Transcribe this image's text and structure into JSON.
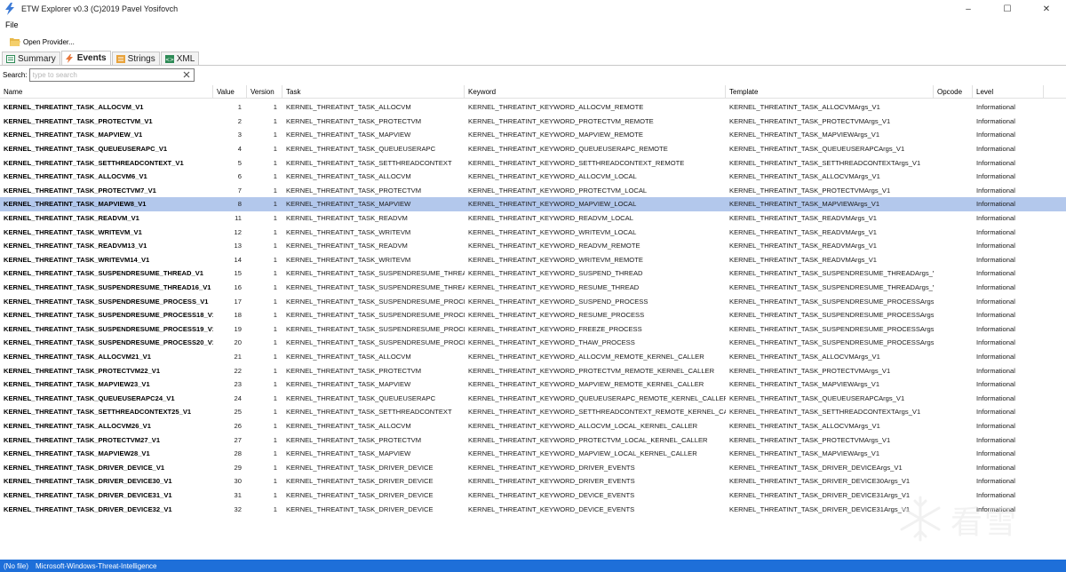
{
  "window": {
    "title": "ETW Explorer v0.3 (C)2019 Pavel Yosifovch",
    "minimize": "–",
    "maximize": "☐",
    "close": "✕"
  },
  "menu": {
    "file": "File"
  },
  "toolbar": {
    "open_provider": "Open Provider..."
  },
  "tabs": [
    {
      "label": "Summary",
      "icon": "summary-icon",
      "active": false
    },
    {
      "label": "Events",
      "icon": "lightning-icon",
      "active": true
    },
    {
      "label": "Strings",
      "icon": "strings-icon",
      "active": false
    },
    {
      "label": "XML",
      "icon": "xml-icon",
      "active": false
    }
  ],
  "search": {
    "label": "Search:",
    "placeholder": "type to search",
    "value": ""
  },
  "columns": {
    "name": "Name",
    "value": "Value",
    "version": "Version",
    "task": "Task",
    "keyword": "Keyword",
    "template": "Template",
    "opcode": "Opcode",
    "level": "Level"
  },
  "rows": [
    [
      "KERNEL_THREATINT_TASK_ALLOCVM_V1",
      "1",
      "1",
      "KERNEL_THREATINT_TASK_ALLOCVM",
      "KERNEL_THREATINT_KEYWORD_ALLOCVM_REMOTE",
      "KERNEL_THREATINT_TASK_ALLOCVMArgs_V1",
      "",
      "Informational"
    ],
    [
      "KERNEL_THREATINT_TASK_PROTECTVM_V1",
      "2",
      "1",
      "KERNEL_THREATINT_TASK_PROTECTVM",
      "KERNEL_THREATINT_KEYWORD_PROTECTVM_REMOTE",
      "KERNEL_THREATINT_TASK_PROTECTVMArgs_V1",
      "",
      "Informational"
    ],
    [
      "KERNEL_THREATINT_TASK_MAPVIEW_V1",
      "3",
      "1",
      "KERNEL_THREATINT_TASK_MAPVIEW",
      "KERNEL_THREATINT_KEYWORD_MAPVIEW_REMOTE",
      "KERNEL_THREATINT_TASK_MAPVIEWArgs_V1",
      "",
      "Informational"
    ],
    [
      "KERNEL_THREATINT_TASK_QUEUEUSERAPC_V1",
      "4",
      "1",
      "KERNEL_THREATINT_TASK_QUEUEUSERAPC",
      "KERNEL_THREATINT_KEYWORD_QUEUEUSERAPC_REMOTE",
      "KERNEL_THREATINT_TASK_QUEUEUSERAPCArgs_V1",
      "",
      "Informational"
    ],
    [
      "KERNEL_THREATINT_TASK_SETTHREADCONTEXT_V1",
      "5",
      "1",
      "KERNEL_THREATINT_TASK_SETTHREADCONTEXT",
      "KERNEL_THREATINT_KEYWORD_SETTHREADCONTEXT_REMOTE",
      "KERNEL_THREATINT_TASK_SETTHREADCONTEXTArgs_V1",
      "",
      "Informational"
    ],
    [
      "KERNEL_THREATINT_TASK_ALLOCVM6_V1",
      "6",
      "1",
      "KERNEL_THREATINT_TASK_ALLOCVM",
      "KERNEL_THREATINT_KEYWORD_ALLOCVM_LOCAL",
      "KERNEL_THREATINT_TASK_ALLOCVMArgs_V1",
      "",
      "Informational"
    ],
    [
      "KERNEL_THREATINT_TASK_PROTECTVM7_V1",
      "7",
      "1",
      "KERNEL_THREATINT_TASK_PROTECTVM",
      "KERNEL_THREATINT_KEYWORD_PROTECTVM_LOCAL",
      "KERNEL_THREATINT_TASK_PROTECTVMArgs_V1",
      "",
      "Informational"
    ],
    [
      "KERNEL_THREATINT_TASK_MAPVIEW8_V1",
      "8",
      "1",
      "KERNEL_THREATINT_TASK_MAPVIEW",
      "KERNEL_THREATINT_KEYWORD_MAPVIEW_LOCAL",
      "KERNEL_THREATINT_TASK_MAPVIEWArgs_V1",
      "",
      "Informational"
    ],
    [
      "KERNEL_THREATINT_TASK_READVM_V1",
      "11",
      "1",
      "KERNEL_THREATINT_TASK_READVM",
      "KERNEL_THREATINT_KEYWORD_READVM_LOCAL",
      "KERNEL_THREATINT_TASK_READVMArgs_V1",
      "",
      "Informational"
    ],
    [
      "KERNEL_THREATINT_TASK_WRITEVM_V1",
      "12",
      "1",
      "KERNEL_THREATINT_TASK_WRITEVM",
      "KERNEL_THREATINT_KEYWORD_WRITEVM_LOCAL",
      "KERNEL_THREATINT_TASK_READVMArgs_V1",
      "",
      "Informational"
    ],
    [
      "KERNEL_THREATINT_TASK_READVM13_V1",
      "13",
      "1",
      "KERNEL_THREATINT_TASK_READVM",
      "KERNEL_THREATINT_KEYWORD_READVM_REMOTE",
      "KERNEL_THREATINT_TASK_READVMArgs_V1",
      "",
      "Informational"
    ],
    [
      "KERNEL_THREATINT_TASK_WRITEVM14_V1",
      "14",
      "1",
      "KERNEL_THREATINT_TASK_WRITEVM",
      "KERNEL_THREATINT_KEYWORD_WRITEVM_REMOTE",
      "KERNEL_THREATINT_TASK_READVMArgs_V1",
      "",
      "Informational"
    ],
    [
      "KERNEL_THREATINT_TASK_SUSPENDRESUME_THREAD_V1",
      "15",
      "1",
      "KERNEL_THREATINT_TASK_SUSPENDRESUME_THREAD",
      "KERNEL_THREATINT_KEYWORD_SUSPEND_THREAD",
      "KERNEL_THREATINT_TASK_SUSPENDRESUME_THREADArgs_V1",
      "",
      "Informational"
    ],
    [
      "KERNEL_THREATINT_TASK_SUSPENDRESUME_THREAD16_V1",
      "16",
      "1",
      "KERNEL_THREATINT_TASK_SUSPENDRESUME_THREAD",
      "KERNEL_THREATINT_KEYWORD_RESUME_THREAD",
      "KERNEL_THREATINT_TASK_SUSPENDRESUME_THREADArgs_V1",
      "",
      "Informational"
    ],
    [
      "KERNEL_THREATINT_TASK_SUSPENDRESUME_PROCESS_V1",
      "17",
      "1",
      "KERNEL_THREATINT_TASK_SUSPENDRESUME_PROCESS",
      "KERNEL_THREATINT_KEYWORD_SUSPEND_PROCESS",
      "KERNEL_THREATINT_TASK_SUSPENDRESUME_PROCESSArgs_V1",
      "",
      "Informational"
    ],
    [
      "KERNEL_THREATINT_TASK_SUSPENDRESUME_PROCESS18_V1",
      "18",
      "1",
      "KERNEL_THREATINT_TASK_SUSPENDRESUME_PROCESS",
      "KERNEL_THREATINT_KEYWORD_RESUME_PROCESS",
      "KERNEL_THREATINT_TASK_SUSPENDRESUME_PROCESSArgs_V1",
      "",
      "Informational"
    ],
    [
      "KERNEL_THREATINT_TASK_SUSPENDRESUME_PROCESS19_V1",
      "19",
      "1",
      "KERNEL_THREATINT_TASK_SUSPENDRESUME_PROCESS",
      "KERNEL_THREATINT_KEYWORD_FREEZE_PROCESS",
      "KERNEL_THREATINT_TASK_SUSPENDRESUME_PROCESSArgs_V1",
      "",
      "Informational"
    ],
    [
      "KERNEL_THREATINT_TASK_SUSPENDRESUME_PROCESS20_V1",
      "20",
      "1",
      "KERNEL_THREATINT_TASK_SUSPENDRESUME_PROCESS",
      "KERNEL_THREATINT_KEYWORD_THAW_PROCESS",
      "KERNEL_THREATINT_TASK_SUSPENDRESUME_PROCESSArgs_V1",
      "",
      "Informational"
    ],
    [
      "KERNEL_THREATINT_TASK_ALLOCVM21_V1",
      "21",
      "1",
      "KERNEL_THREATINT_TASK_ALLOCVM",
      "KERNEL_THREATINT_KEYWORD_ALLOCVM_REMOTE_KERNEL_CALLER",
      "KERNEL_THREATINT_TASK_ALLOCVMArgs_V1",
      "",
      "Informational"
    ],
    [
      "KERNEL_THREATINT_TASK_PROTECTVM22_V1",
      "22",
      "1",
      "KERNEL_THREATINT_TASK_PROTECTVM",
      "KERNEL_THREATINT_KEYWORD_PROTECTVM_REMOTE_KERNEL_CALLER",
      "KERNEL_THREATINT_TASK_PROTECTVMArgs_V1",
      "",
      "Informational"
    ],
    [
      "KERNEL_THREATINT_TASK_MAPVIEW23_V1",
      "23",
      "1",
      "KERNEL_THREATINT_TASK_MAPVIEW",
      "KERNEL_THREATINT_KEYWORD_MAPVIEW_REMOTE_KERNEL_CALLER",
      "KERNEL_THREATINT_TASK_MAPVIEWArgs_V1",
      "",
      "Informational"
    ],
    [
      "KERNEL_THREATINT_TASK_QUEUEUSERAPC24_V1",
      "24",
      "1",
      "KERNEL_THREATINT_TASK_QUEUEUSERAPC",
      "KERNEL_THREATINT_KEYWORD_QUEUEUSERAPC_REMOTE_KERNEL_CALLER",
      "KERNEL_THREATINT_TASK_QUEUEUSERAPCArgs_V1",
      "",
      "Informational"
    ],
    [
      "KERNEL_THREATINT_TASK_SETTHREADCONTEXT25_V1",
      "25",
      "1",
      "KERNEL_THREATINT_TASK_SETTHREADCONTEXT",
      "KERNEL_THREATINT_KEYWORD_SETTHREADCONTEXT_REMOTE_KERNEL_CALLER",
      "KERNEL_THREATINT_TASK_SETTHREADCONTEXTArgs_V1",
      "",
      "Informational"
    ],
    [
      "KERNEL_THREATINT_TASK_ALLOCVM26_V1",
      "26",
      "1",
      "KERNEL_THREATINT_TASK_ALLOCVM",
      "KERNEL_THREATINT_KEYWORD_ALLOCVM_LOCAL_KERNEL_CALLER",
      "KERNEL_THREATINT_TASK_ALLOCVMArgs_V1",
      "",
      "Informational"
    ],
    [
      "KERNEL_THREATINT_TASK_PROTECTVM27_V1",
      "27",
      "1",
      "KERNEL_THREATINT_TASK_PROTECTVM",
      "KERNEL_THREATINT_KEYWORD_PROTECTVM_LOCAL_KERNEL_CALLER",
      "KERNEL_THREATINT_TASK_PROTECTVMArgs_V1",
      "",
      "Informational"
    ],
    [
      "KERNEL_THREATINT_TASK_MAPVIEW28_V1",
      "28",
      "1",
      "KERNEL_THREATINT_TASK_MAPVIEW",
      "KERNEL_THREATINT_KEYWORD_MAPVIEW_LOCAL_KERNEL_CALLER",
      "KERNEL_THREATINT_TASK_MAPVIEWArgs_V1",
      "",
      "Informational"
    ],
    [
      "KERNEL_THREATINT_TASK_DRIVER_DEVICE_V1",
      "29",
      "1",
      "KERNEL_THREATINT_TASK_DRIVER_DEVICE",
      "KERNEL_THREATINT_KEYWORD_DRIVER_EVENTS",
      "KERNEL_THREATINT_TASK_DRIVER_DEVICEArgs_V1",
      "",
      "Informational"
    ],
    [
      "KERNEL_THREATINT_TASK_DRIVER_DEVICE30_V1",
      "30",
      "1",
      "KERNEL_THREATINT_TASK_DRIVER_DEVICE",
      "KERNEL_THREATINT_KEYWORD_DRIVER_EVENTS",
      "KERNEL_THREATINT_TASK_DRIVER_DEVICE30Args_V1",
      "",
      "Informational"
    ],
    [
      "KERNEL_THREATINT_TASK_DRIVER_DEVICE31_V1",
      "31",
      "1",
      "KERNEL_THREATINT_TASK_DRIVER_DEVICE",
      "KERNEL_THREATINT_KEYWORD_DEVICE_EVENTS",
      "KERNEL_THREATINT_TASK_DRIVER_DEVICE31Args_V1",
      "",
      "Informational"
    ],
    [
      "KERNEL_THREATINT_TASK_DRIVER_DEVICE32_V1",
      "32",
      "1",
      "KERNEL_THREATINT_TASK_DRIVER_DEVICE",
      "KERNEL_THREATINT_KEYWORD_DEVICE_EVENTS",
      "KERNEL_THREATINT_TASK_DRIVER_DEVICE31Args_V1",
      "",
      "Informational"
    ]
  ],
  "selected_row": 7,
  "status": {
    "file": "(No file)",
    "provider": "Microsoft-Windows-Threat-Intelligence"
  },
  "watermark": {
    "text": "看雪"
  },
  "colors": {
    "selection": "#b3c8ec",
    "statusbar": "#1e6fd9",
    "icon_orange": "#e8a33c"
  }
}
